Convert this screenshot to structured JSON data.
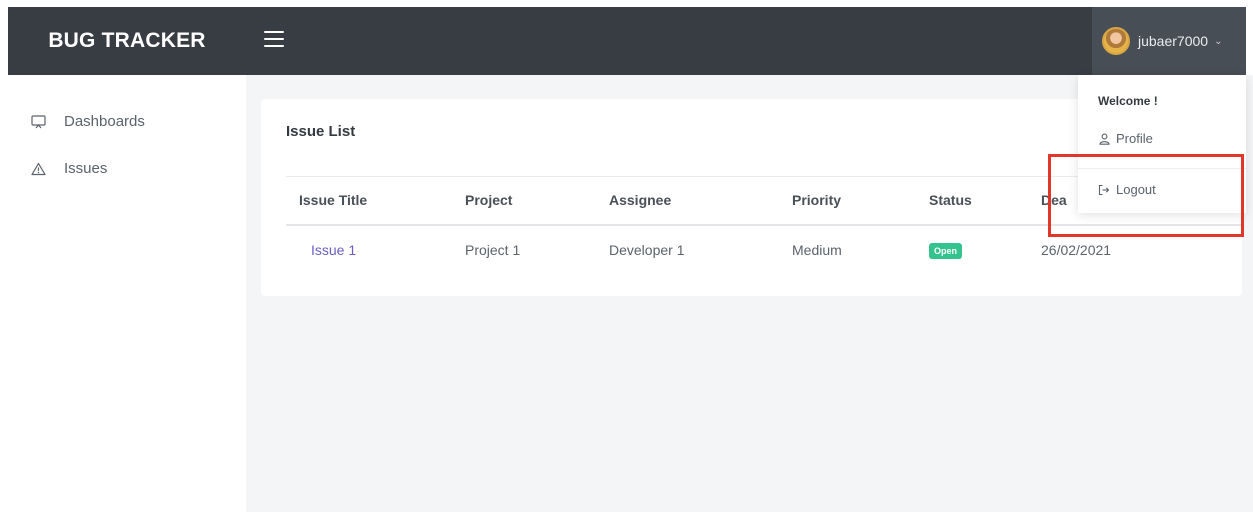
{
  "app": {
    "brand": "BUG TRACKER"
  },
  "user": {
    "name": "jubaer7000",
    "caret": "⌄"
  },
  "sidebar": {
    "items": [
      {
        "label": "Dashboards",
        "icon": "monitor-icon"
      },
      {
        "label": "Issues",
        "icon": "warning-triangle-icon"
      }
    ]
  },
  "card": {
    "title": "Issue List",
    "columns": [
      "Issue Title",
      "Project",
      "Assignee",
      "Priority",
      "Status",
      "Dea"
    ],
    "rows": [
      {
        "title": "Issue 1",
        "project": "Project 1",
        "assignee": "Developer 1",
        "priority": "Medium",
        "status": "Open",
        "deadline": "26/02/2021"
      }
    ]
  },
  "dropdown": {
    "welcome": "Welcome !",
    "profile": "Profile",
    "logout": "Logout"
  },
  "colors": {
    "topbar": "#383d44",
    "user_box": "#484e56",
    "link": "#6b5fc5",
    "badge_open": "#34c38f",
    "highlight": "#e0372a"
  }
}
